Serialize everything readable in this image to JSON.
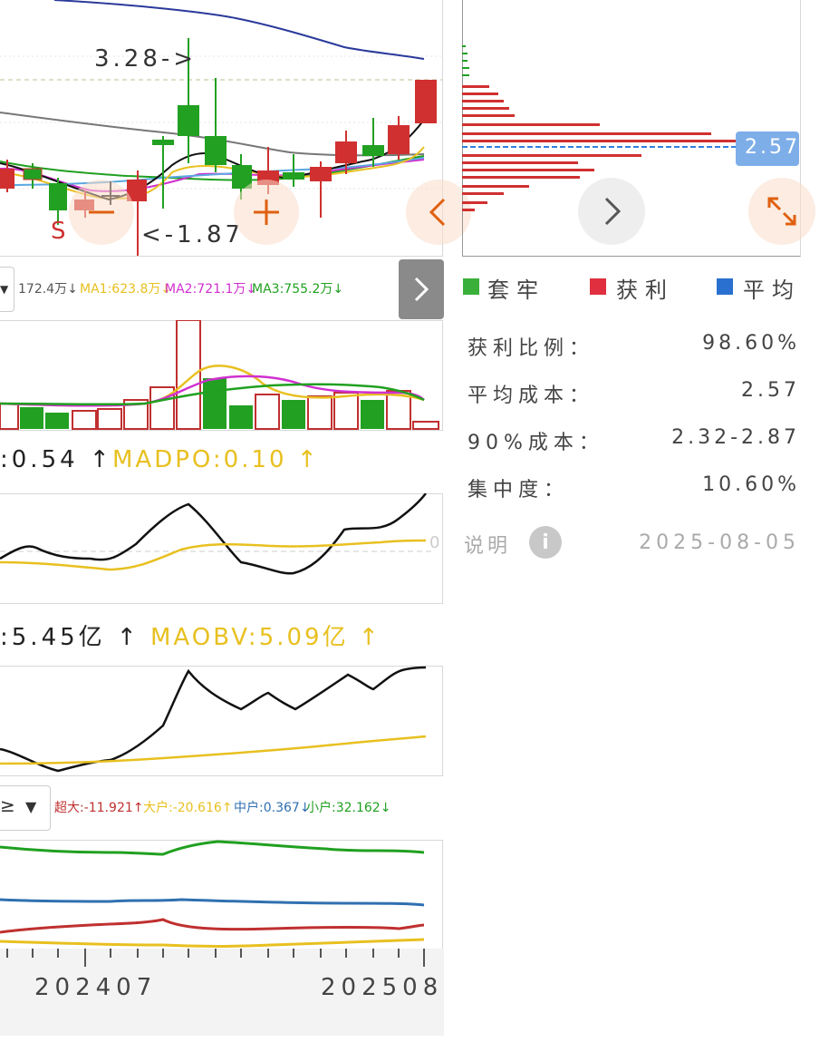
{
  "main_chart": {
    "label_high": "3.28->",
    "label_low": "<-1.87",
    "sell_marker": "S"
  },
  "volume": {
    "legend_vol": "172.4万↓",
    "legend_ma1": "MA1:623.8万↓",
    "legend_ma2": "MA2:721.1万↓",
    "legend_ma3": "MA3:755.2万↓"
  },
  "macd": {
    "label_dpo": ":0.54 ↑",
    "label_madpo": "MADPO:0.10 ↑",
    "zero_label": "0"
  },
  "obv": {
    "label_obv": ":5.45亿 ↑",
    "label_maobv": "MAOBV:5.09亿 ↑"
  },
  "fund_flow": {
    "selector_partial": "≥",
    "legend_super": "超大:-11.921↑",
    "legend_large": "大户:-20.616↑",
    "legend_mid": "中户:0.367↓",
    "legend_small": "小户:32.162↓"
  },
  "x_axis": {
    "tick_left": "202407",
    "tick_right": "202508"
  },
  "chip": {
    "price_tag": "2.57",
    "legend_trapped": "套牢",
    "legend_profit": "获利",
    "legend_avg": "平均",
    "profit_ratio_label": "获利比例：",
    "profit_ratio_value": "98.60%",
    "avg_cost_label": "平均成本：",
    "avg_cost_value": "2.57",
    "cost90_label": "90%成本：",
    "cost90_value": "2.32-2.87",
    "concentration_label": "集中度：",
    "concentration_value": "10.60%",
    "explain_label": "说明",
    "date": "2025-08-05"
  },
  "colors": {
    "up_red": "#d03030",
    "down_green": "#22a022",
    "ma_yellow": "#e8c020",
    "ma_magenta": "#d030d0",
    "ma_green": "#20a020",
    "navy": "#2a3a9a",
    "avg_blue": "#3080e0",
    "accent_orange": "#e06010"
  }
}
